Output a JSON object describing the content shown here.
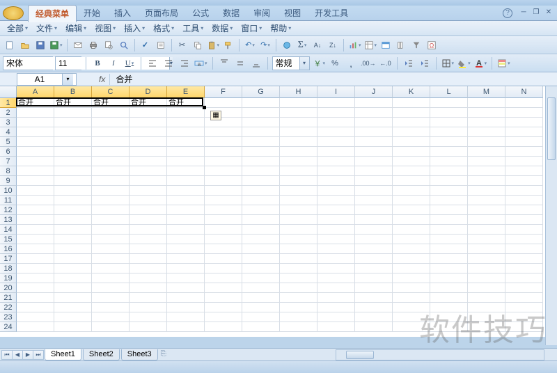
{
  "ribbon": {
    "tabs": [
      "经典菜单",
      "开始",
      "插入",
      "页面布局",
      "公式",
      "数据",
      "审阅",
      "视图",
      "开发工具"
    ],
    "active_index": 0
  },
  "menu": {
    "items": [
      "全部",
      "文件",
      "编辑",
      "视图",
      "插入",
      "格式",
      "工具",
      "数据",
      "窗口",
      "帮助"
    ]
  },
  "font": {
    "name": "宋体",
    "size": "11",
    "number_format": "常规"
  },
  "namebox": {
    "ref": "A1"
  },
  "formula": {
    "fx_label": "fx",
    "value": "合并"
  },
  "grid": {
    "col_width_first5": 54,
    "col_width_rest": 54,
    "columns": [
      "A",
      "B",
      "C",
      "D",
      "E",
      "F",
      "G",
      "H",
      "I",
      "J",
      "K",
      "L",
      "M",
      "N"
    ],
    "selected_cols": [
      0,
      1,
      2,
      3,
      4
    ],
    "rows": 24,
    "selected_row": 0,
    "row1_values": [
      "合并",
      "合并",
      "合并",
      "合并",
      "合并"
    ]
  },
  "sheets": {
    "tabs": [
      "Sheet1",
      "Sheet2",
      "Sheet3"
    ],
    "active": 0
  },
  "watermark": "软件技巧"
}
